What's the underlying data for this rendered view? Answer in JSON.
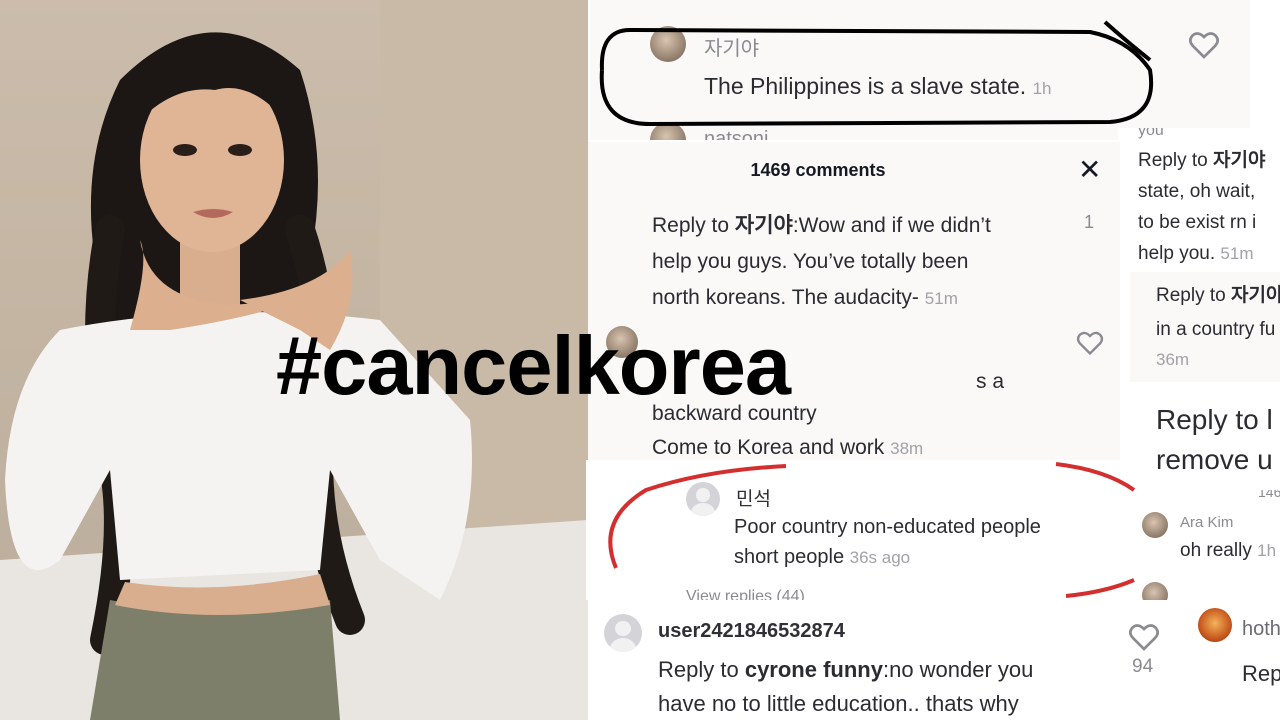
{
  "overlay_text": "#cancelkorea",
  "colors": {
    "annotation_black": "#000000",
    "annotation_red": "#d32f2f",
    "timestamp": "#a1a2a7"
  },
  "card1": {
    "username": "자기야",
    "comment": "The Philippines is a slave state.",
    "time": "1h",
    "cut_username": "natsoni"
  },
  "card2": {
    "header": "1469 comments",
    "reply_prefix": "Reply to ",
    "reply_target": "자기야",
    "line1_rest": ":Wow and if we didn’t",
    "line2": "help you guys. You’ve totally been",
    "line3": "north koreans. The audacity-",
    "time": "51m",
    "count_right": "1",
    "partial_line": "s a",
    "line_backward": "backward country",
    "line_come": "Come to Korea and work",
    "time2": "38m"
  },
  "card3": {
    "partial_user": "you",
    "reply_prefix": "Reply to ",
    "reply_target": "자기야",
    "line2": "state, oh wait,",
    "line3": "to be exist rn i",
    "line4": "help you.",
    "time": "51m"
  },
  "card4": {
    "reply_prefix": "Reply to ",
    "reply_target": "자기야",
    "line2": "in a country fu",
    "time": "36m"
  },
  "card5": {
    "line1": "Reply to l",
    "line2": "remove u"
  },
  "card6": {
    "username": "민석",
    "line1": "Poor country non-educated people",
    "line2": "short people",
    "time": "36s ago",
    "view_replies": "View replies (44)"
  },
  "card7": {
    "username": "Ara Kim",
    "comment": "oh really",
    "time": "1h",
    "partial_count": "146"
  },
  "card8": {
    "username": "user2421846532874",
    "reply_prefix": "Reply to ",
    "reply_target": "cyrone funny",
    "line1_rest": ":no wonder you",
    "line2": "have no to little education.. thats why",
    "like_count": "94"
  },
  "card9": {
    "username": "hoth",
    "partial": "Rep"
  }
}
